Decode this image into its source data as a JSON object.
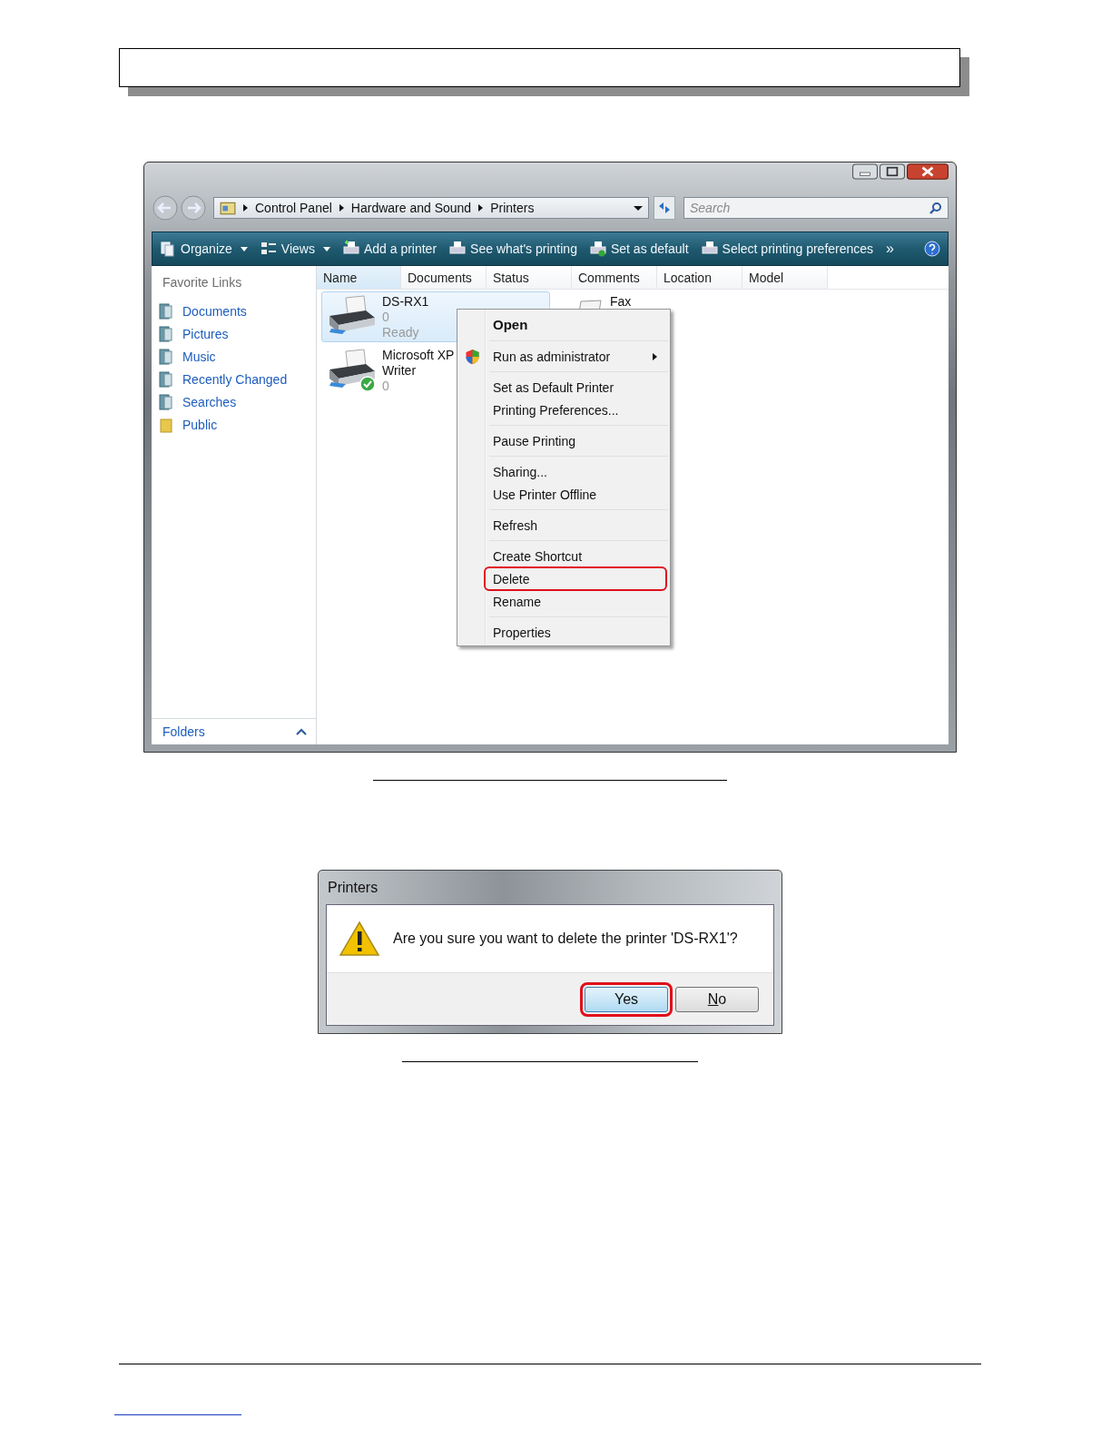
{
  "explorer": {
    "address": [
      "Control Panel",
      "Hardware and Sound",
      "Printers"
    ],
    "search": {
      "placeholder": "Search"
    },
    "toolbar": [
      {
        "label": "Organize",
        "kind": "dropdown"
      },
      {
        "label": "Views",
        "kind": "dropdown"
      },
      {
        "label": "Add a printer",
        "kind": "button"
      },
      {
        "label": "See what's printing",
        "kind": "button"
      },
      {
        "label": "Set as default",
        "kind": "button"
      },
      {
        "label": "Select printing preferences",
        "kind": "button"
      }
    ],
    "overflow": "»",
    "favorite_links": {
      "title": "Favorite Links",
      "items": [
        "Documents",
        "Pictures",
        "Music",
        "Recently Changed",
        "Searches",
        "Public"
      ]
    },
    "folders": "Folders",
    "columns": [
      "Name",
      "Documents",
      "Status",
      "Comments",
      "Location",
      "Model"
    ],
    "items": [
      {
        "kind": "printer",
        "name_lines": [
          "DS-RX1"
        ],
        "detail_lines": [
          "0",
          "Ready"
        ],
        "selected": true,
        "default": false
      },
      {
        "kind": "printer",
        "name_lines": [
          "Microsoft XP",
          "Writer"
        ],
        "detail_lines": [
          "0"
        ],
        "selected": false,
        "default": true
      },
      {
        "kind": "fax",
        "name_lines": [
          "Fax"
        ],
        "selected": false
      }
    ],
    "context_menu": [
      [
        {
          "label": "Open",
          "bold": true,
          "submenu": false,
          "shield": false,
          "annotated": false
        }
      ],
      [
        {
          "label": "Run as administrator",
          "bold": false,
          "submenu": true,
          "shield": true,
          "annotated": false
        }
      ],
      [
        {
          "label": "Set as Default Printer",
          "bold": false,
          "submenu": false,
          "shield": false,
          "annotated": false
        },
        {
          "label": "Printing Preferences...",
          "bold": false,
          "submenu": false,
          "shield": false,
          "annotated": false
        }
      ],
      [
        {
          "label": "Pause Printing",
          "bold": false,
          "submenu": false,
          "shield": false,
          "annotated": false
        }
      ],
      [
        {
          "label": "Sharing...",
          "bold": false,
          "submenu": false,
          "shield": false,
          "annotated": false
        },
        {
          "label": "Use Printer Offline",
          "bold": false,
          "submenu": false,
          "shield": false,
          "annotated": false
        }
      ],
      [
        {
          "label": "Refresh",
          "bold": false,
          "submenu": false,
          "shield": false,
          "annotated": false
        }
      ],
      [
        {
          "label": "Create Shortcut",
          "bold": false,
          "submenu": false,
          "shield": false,
          "annotated": false
        },
        {
          "label": "Delete",
          "bold": false,
          "submenu": false,
          "shield": false,
          "annotated": true
        },
        {
          "label": "Rename",
          "bold": false,
          "submenu": false,
          "shield": false,
          "annotated": false
        }
      ],
      [
        {
          "label": "Properties",
          "bold": false,
          "submenu": false,
          "shield": false,
          "annotated": false
        }
      ]
    ]
  },
  "dialog": {
    "title": "Printers",
    "message": "Are you sure you want to delete the printer 'DS-RX1'?",
    "buttons": [
      {
        "label": "Yes",
        "mnemonic": false,
        "default": true,
        "annotated": true
      },
      {
        "label": "No",
        "mnemonic": true,
        "default": false,
        "annotated": false
      }
    ]
  }
}
